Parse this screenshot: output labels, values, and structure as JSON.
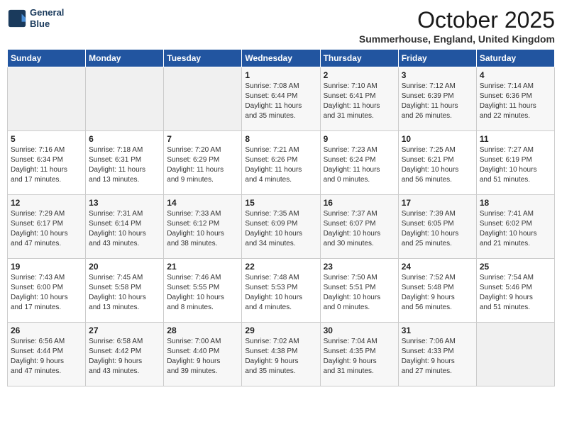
{
  "logo": {
    "line1": "General",
    "line2": "Blue"
  },
  "title": "October 2025",
  "location": "Summerhouse, England, United Kingdom",
  "days_of_week": [
    "Sunday",
    "Monday",
    "Tuesday",
    "Wednesday",
    "Thursday",
    "Friday",
    "Saturday"
  ],
  "weeks": [
    [
      {
        "day": "",
        "info": ""
      },
      {
        "day": "",
        "info": ""
      },
      {
        "day": "",
        "info": ""
      },
      {
        "day": "1",
        "info": "Sunrise: 7:08 AM\nSunset: 6:44 PM\nDaylight: 11 hours\nand 35 minutes."
      },
      {
        "day": "2",
        "info": "Sunrise: 7:10 AM\nSunset: 6:41 PM\nDaylight: 11 hours\nand 31 minutes."
      },
      {
        "day": "3",
        "info": "Sunrise: 7:12 AM\nSunset: 6:39 PM\nDaylight: 11 hours\nand 26 minutes."
      },
      {
        "day": "4",
        "info": "Sunrise: 7:14 AM\nSunset: 6:36 PM\nDaylight: 11 hours\nand 22 minutes."
      }
    ],
    [
      {
        "day": "5",
        "info": "Sunrise: 7:16 AM\nSunset: 6:34 PM\nDaylight: 11 hours\nand 17 minutes."
      },
      {
        "day": "6",
        "info": "Sunrise: 7:18 AM\nSunset: 6:31 PM\nDaylight: 11 hours\nand 13 minutes."
      },
      {
        "day": "7",
        "info": "Sunrise: 7:20 AM\nSunset: 6:29 PM\nDaylight: 11 hours\nand 9 minutes."
      },
      {
        "day": "8",
        "info": "Sunrise: 7:21 AM\nSunset: 6:26 PM\nDaylight: 11 hours\nand 4 minutes."
      },
      {
        "day": "9",
        "info": "Sunrise: 7:23 AM\nSunset: 6:24 PM\nDaylight: 11 hours\nand 0 minutes."
      },
      {
        "day": "10",
        "info": "Sunrise: 7:25 AM\nSunset: 6:21 PM\nDaylight: 10 hours\nand 56 minutes."
      },
      {
        "day": "11",
        "info": "Sunrise: 7:27 AM\nSunset: 6:19 PM\nDaylight: 10 hours\nand 51 minutes."
      }
    ],
    [
      {
        "day": "12",
        "info": "Sunrise: 7:29 AM\nSunset: 6:17 PM\nDaylight: 10 hours\nand 47 minutes."
      },
      {
        "day": "13",
        "info": "Sunrise: 7:31 AM\nSunset: 6:14 PM\nDaylight: 10 hours\nand 43 minutes."
      },
      {
        "day": "14",
        "info": "Sunrise: 7:33 AM\nSunset: 6:12 PM\nDaylight: 10 hours\nand 38 minutes."
      },
      {
        "day": "15",
        "info": "Sunrise: 7:35 AM\nSunset: 6:09 PM\nDaylight: 10 hours\nand 34 minutes."
      },
      {
        "day": "16",
        "info": "Sunrise: 7:37 AM\nSunset: 6:07 PM\nDaylight: 10 hours\nand 30 minutes."
      },
      {
        "day": "17",
        "info": "Sunrise: 7:39 AM\nSunset: 6:05 PM\nDaylight: 10 hours\nand 25 minutes."
      },
      {
        "day": "18",
        "info": "Sunrise: 7:41 AM\nSunset: 6:02 PM\nDaylight: 10 hours\nand 21 minutes."
      }
    ],
    [
      {
        "day": "19",
        "info": "Sunrise: 7:43 AM\nSunset: 6:00 PM\nDaylight: 10 hours\nand 17 minutes."
      },
      {
        "day": "20",
        "info": "Sunrise: 7:45 AM\nSunset: 5:58 PM\nDaylight: 10 hours\nand 13 minutes."
      },
      {
        "day": "21",
        "info": "Sunrise: 7:46 AM\nSunset: 5:55 PM\nDaylight: 10 hours\nand 8 minutes."
      },
      {
        "day": "22",
        "info": "Sunrise: 7:48 AM\nSunset: 5:53 PM\nDaylight: 10 hours\nand 4 minutes."
      },
      {
        "day": "23",
        "info": "Sunrise: 7:50 AM\nSunset: 5:51 PM\nDaylight: 10 hours\nand 0 minutes."
      },
      {
        "day": "24",
        "info": "Sunrise: 7:52 AM\nSunset: 5:48 PM\nDaylight: 9 hours\nand 56 minutes."
      },
      {
        "day": "25",
        "info": "Sunrise: 7:54 AM\nSunset: 5:46 PM\nDaylight: 9 hours\nand 51 minutes."
      }
    ],
    [
      {
        "day": "26",
        "info": "Sunrise: 6:56 AM\nSunset: 4:44 PM\nDaylight: 9 hours\nand 47 minutes."
      },
      {
        "day": "27",
        "info": "Sunrise: 6:58 AM\nSunset: 4:42 PM\nDaylight: 9 hours\nand 43 minutes."
      },
      {
        "day": "28",
        "info": "Sunrise: 7:00 AM\nSunset: 4:40 PM\nDaylight: 9 hours\nand 39 minutes."
      },
      {
        "day": "29",
        "info": "Sunrise: 7:02 AM\nSunset: 4:38 PM\nDaylight: 9 hours\nand 35 minutes."
      },
      {
        "day": "30",
        "info": "Sunrise: 7:04 AM\nSunset: 4:35 PM\nDaylight: 9 hours\nand 31 minutes."
      },
      {
        "day": "31",
        "info": "Sunrise: 7:06 AM\nSunset: 4:33 PM\nDaylight: 9 hours\nand 27 minutes."
      },
      {
        "day": "",
        "info": ""
      }
    ]
  ]
}
